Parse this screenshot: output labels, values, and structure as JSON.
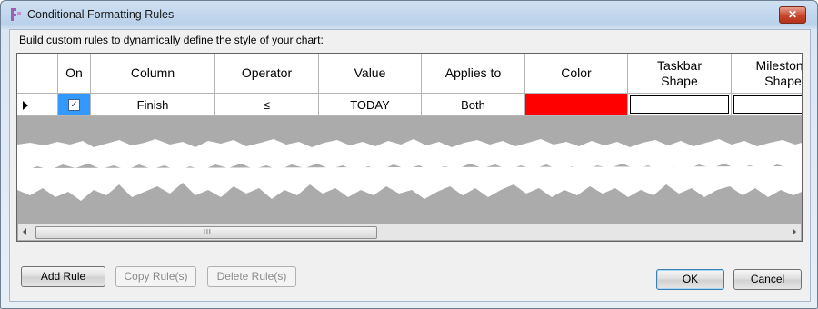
{
  "window": {
    "title": "Conditional Formatting Rules",
    "close_label": "✕"
  },
  "instructions": "Build custom rules to dynamically define the style of your chart:",
  "grid": {
    "columns": [
      "On",
      "Column",
      "Operator",
      "Value",
      "Applies to",
      "Color",
      "Taskbar Shape",
      "Milestone Shape"
    ],
    "row": {
      "on_checked": true,
      "check_glyph": "✓",
      "column": "Finish",
      "operator": "≤",
      "value": "TODAY",
      "applies_to": "Both",
      "color": "#ff0000"
    }
  },
  "scrollbar": {
    "grip": "III"
  },
  "buttons": {
    "add_rule": "Add Rule",
    "copy_rules": "Copy Rule(s)",
    "delete_rules": "Delete Rule(s)",
    "ok": "OK",
    "cancel": "Cancel"
  }
}
